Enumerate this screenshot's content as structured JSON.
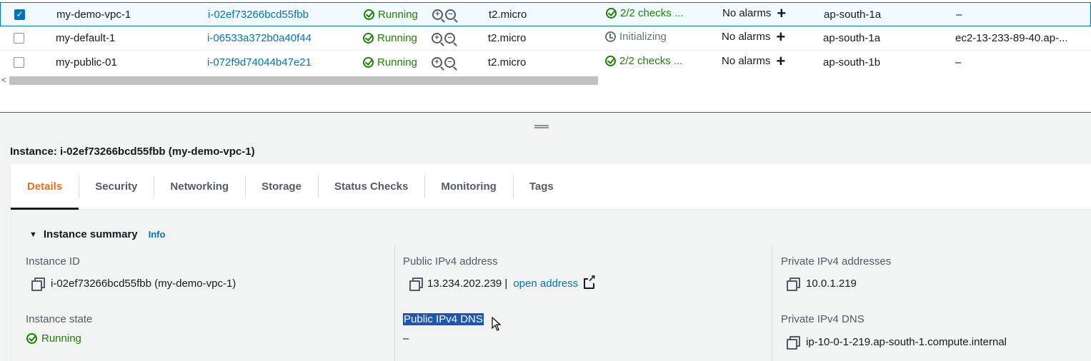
{
  "instances": [
    {
      "name": "my-demo-vpc-1",
      "id": "i-02ef73266bcd55fbb",
      "state": "Running",
      "type": "t2.micro",
      "status_check": "2/2 checks ...",
      "status_kind": "ok",
      "alarm": "No alarms",
      "az": "ap-south-1a",
      "public_dns": "–",
      "selected": true
    },
    {
      "name": "my-default-1",
      "id": "i-06533a372b0a40f44",
      "state": "Running",
      "type": "t2.micro",
      "status_check": "Initializing",
      "status_kind": "init",
      "alarm": "No alarms",
      "az": "ap-south-1a",
      "public_dns": "ec2-13-233-89-40.ap-...",
      "selected": false
    },
    {
      "name": "my-public-01",
      "id": "i-072f9d74044b47e21",
      "state": "Running",
      "type": "t2.micro",
      "status_check": "2/2 checks ...",
      "status_kind": "ok",
      "alarm": "No alarms",
      "az": "ap-south-1b",
      "public_dns": "–",
      "selected": false
    }
  ],
  "panel": {
    "title": "Instance: i-02ef73266bcd55fbb (my-demo-vpc-1)"
  },
  "tabs": [
    {
      "label": "Details",
      "active": true
    },
    {
      "label": "Security"
    },
    {
      "label": "Networking"
    },
    {
      "label": "Storage"
    },
    {
      "label": "Status Checks"
    },
    {
      "label": "Monitoring"
    },
    {
      "label": "Tags"
    }
  ],
  "summary": {
    "heading": "Instance summary",
    "info": "Info",
    "instance_id_label": "Instance ID",
    "instance_id_value": "i-02ef73266bcd55fbb (my-demo-vpc-1)",
    "public_ipv4_label": "Public IPv4 address",
    "public_ipv4_value": "13.234.202.239 |",
    "open_address": "open address",
    "private_ipv4_label": "Private IPv4 addresses",
    "private_ipv4_value": "10.0.1.219",
    "instance_state_label": "Instance state",
    "instance_state_value": "Running",
    "public_dns_label": "Public IPv4 DNS",
    "public_dns_value": "–",
    "private_dns_label": "Private IPv4 DNS",
    "private_dns_value": "ip-10-0-1-219.ap-south-1.compute.internal"
  },
  "colors": {
    "accent": "#0073bb",
    "success": "#1d8102",
    "active_tab": "#ec7211",
    "selection": "#1c55b3"
  }
}
